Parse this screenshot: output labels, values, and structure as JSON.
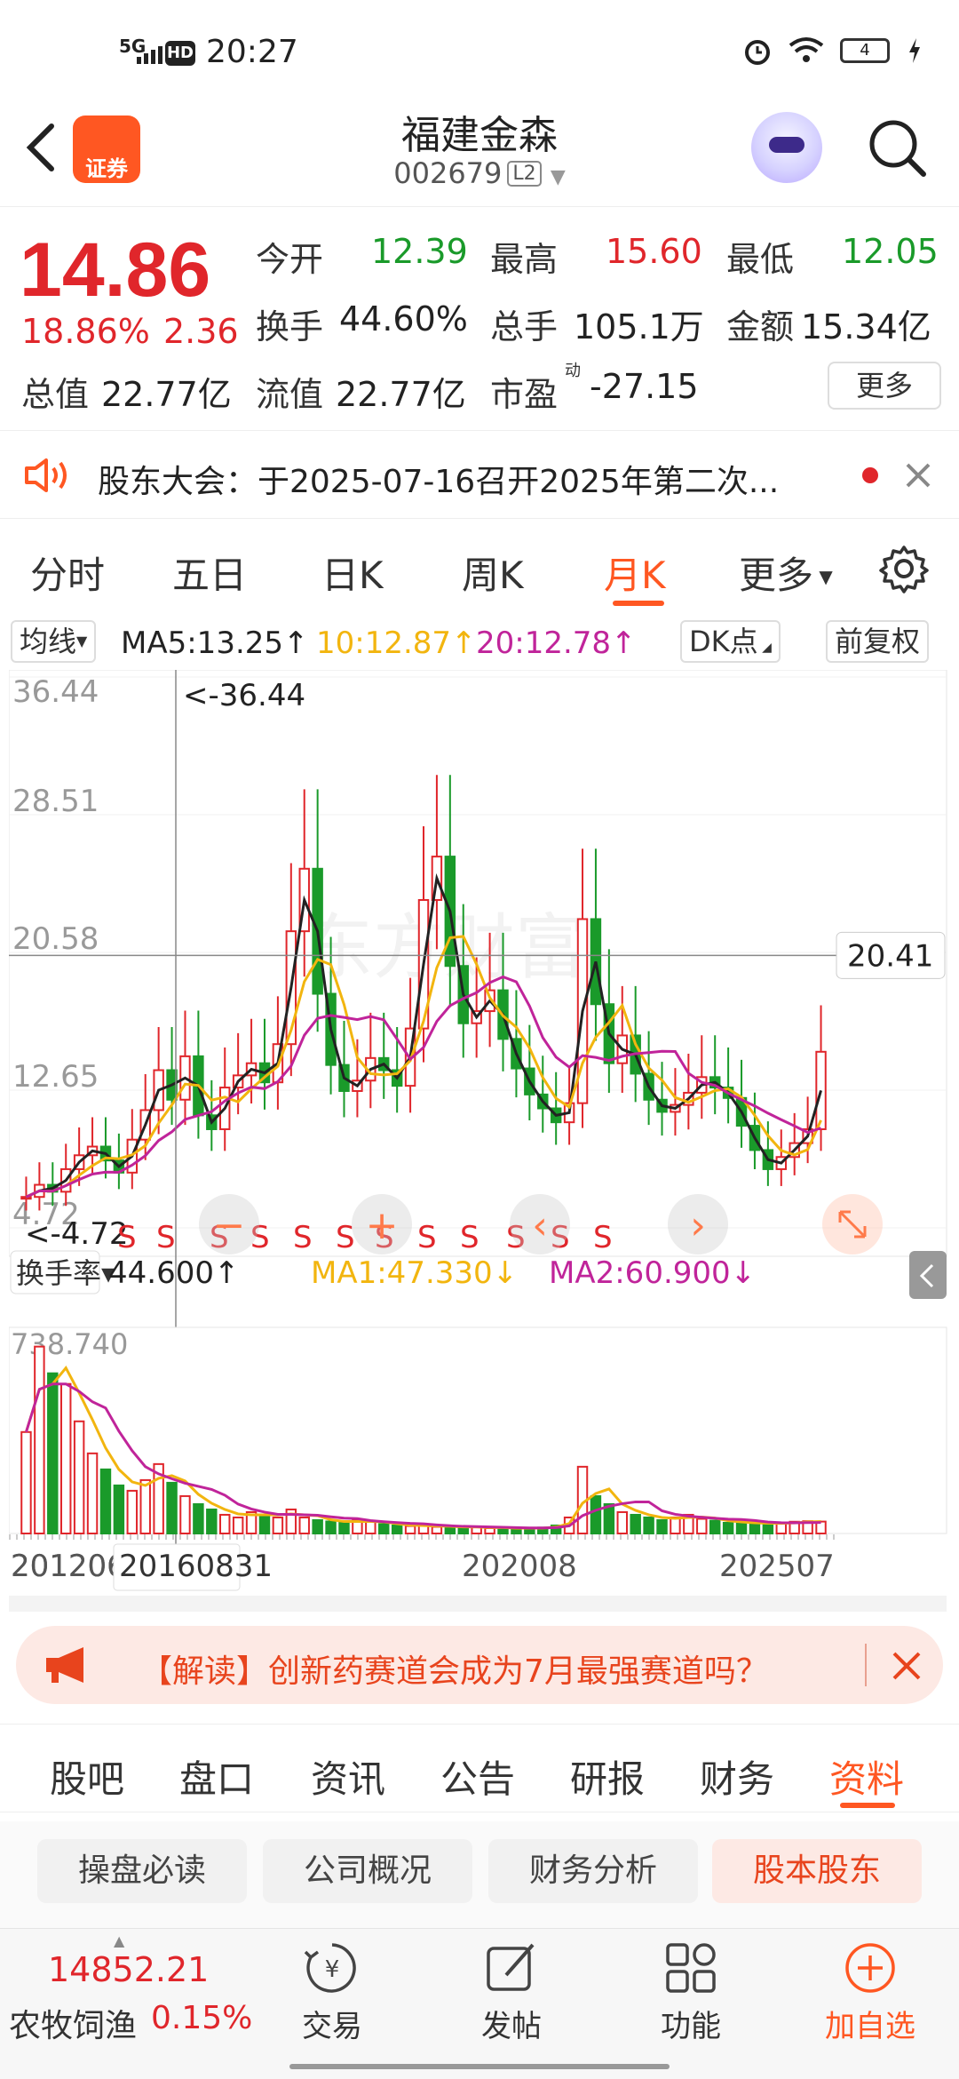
{
  "status": {
    "network": "5G",
    "hd": "HD",
    "time": "20:27",
    "battery": "4"
  },
  "header": {
    "logo_text": "证券",
    "stock_name": "福建金森",
    "stock_code": "002679",
    "level_badge": "L2"
  },
  "quote": {
    "price": "14.86",
    "change_pct": "18.86%",
    "change": "2.36",
    "open_label": "今开",
    "open": "12.39",
    "high_label": "最高",
    "high": "15.60",
    "low_label": "最低",
    "low": "12.05",
    "turnover_label": "换手",
    "turnover": "44.60%",
    "volume_label": "总手",
    "volume": "105.1万",
    "amount_label": "金额",
    "amount": "15.34亿",
    "mktcap_label": "总值",
    "mktcap": "22.77亿",
    "float_label": "流值",
    "float_cap": "22.77亿",
    "pe_label": "市盈",
    "pe_sup": "动",
    "pe": "-27.15",
    "more_label": "更多"
  },
  "notice": {
    "text": "股东大会：于2025-07-16召开2025年第二次..."
  },
  "period_tabs": [
    "分时",
    "五日",
    "日K",
    "周K",
    "月K",
    "更多"
  ],
  "ma_row": {
    "ma_select": "均线",
    "ma5": "MA5:13.25↑",
    "ma10": "10:12.87↑",
    "ma20": "20:12.78↑",
    "dk_label": "DK点",
    "adjust_label": "前复权"
  },
  "colors": {
    "up": "#e0262b",
    "down": "#1a9a2a",
    "ma5": "#222222",
    "ma10": "#f2b50f",
    "ma20": "#c0249a",
    "accent": "#ff5722"
  },
  "chart_data": [
    {
      "type": "candlestick",
      "title": "",
      "y_ticks": [
        "36.44",
        "28.51",
        "20.58",
        "12.65",
        "4.72"
      ],
      "ylim": [
        4.72,
        36.44
      ],
      "crosshair_price": "20.41",
      "max_label": "<-36.44",
      "min_label": "<-4.72",
      "signal_marks": [
        "S",
        "S",
        "S",
        "S",
        "S",
        "S",
        "S",
        "S",
        "S",
        "S",
        "S",
        "S"
      ],
      "series": [
        {
          "name": "MA5",
          "value": 13.25
        },
        {
          "name": "MA10",
          "value": 12.87
        },
        {
          "name": "MA20",
          "value": 12.78
        }
      ],
      "approx_close": [
        6.5,
        7.2,
        6.8,
        8.1,
        8.9,
        9.4,
        8.6,
        7.9,
        9.8,
        11.5,
        13.8,
        12.1,
        14.6,
        11.2,
        10.4,
        12.8,
        13.5,
        14.2,
        13.1,
        15.3,
        21.8,
        25.4,
        18.2,
        14.1,
        12.6,
        13.2,
        14.5,
        13.8,
        12.9,
        16.2,
        23.6,
        26.1,
        19.8,
        16.5,
        17.2,
        18.4,
        15.6,
        13.9,
        12.4,
        11.6,
        10.8,
        11.9,
        22.5,
        17.6,
        14.2,
        15.8,
        13.6,
        12.1,
        11.4,
        11.8,
        12.5,
        13.4,
        12.8,
        12.2,
        10.6,
        9.2,
        8.1,
        8.8,
        9.6,
        10.4,
        14.86
      ],
      "x_labels": [
        "201206",
        "20160831",
        "202008",
        "202507"
      ]
    },
    {
      "type": "bar",
      "indicator_label": "换手率",
      "value_label": "44.600↑",
      "ma1": "MA1:47.330↓",
      "ma2": "MA2:60.900↓",
      "y_max_label": "738.740",
      "values": [
        380,
        700,
        600,
        560,
        420,
        300,
        240,
        180,
        160,
        200,
        260,
        190,
        140,
        110,
        90,
        70,
        60,
        80,
        70,
        60,
        90,
        60,
        50,
        45,
        40,
        50,
        45,
        35,
        30,
        28,
        30,
        25,
        26,
        22,
        24,
        20,
        22,
        18,
        20,
        22,
        30,
        60,
        250,
        140,
        110,
        80,
        70,
        60,
        50,
        60,
        70,
        55,
        48,
        40,
        42,
        38,
        35,
        40,
        44,
        46,
        44.6
      ]
    }
  ],
  "banner": {
    "text": "【解读】创新药赛道会成为7月最强赛道吗？"
  },
  "info_tabs": [
    "股吧",
    "盘口",
    "资讯",
    "公告",
    "研报",
    "财务",
    "资料"
  ],
  "sub_tabs": [
    "操盘必读",
    "公司概况",
    "财务分析",
    "股本股东"
  ],
  "bottom_nav": {
    "index_value": "14852.21",
    "index_name": "农牧饲渔",
    "index_pct": "0.15%",
    "items": [
      "交易",
      "发帖",
      "功能",
      "加自选"
    ]
  }
}
